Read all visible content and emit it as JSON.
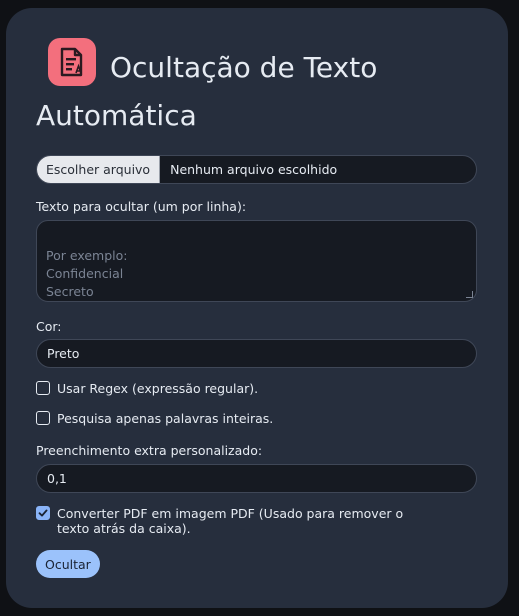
{
  "header": {
    "title": "Ocultação de Texto Automática",
    "icon": "document-redact-icon",
    "icon_color": "#f36f7d"
  },
  "file_input": {
    "button_label": "Escolher arquivo",
    "status": "Nenhum arquivo escolhido"
  },
  "text_area": {
    "label": "Texto para ocultar (um por linha):",
    "placeholder": "Por exemplo:\nConfidencial\nSecreto",
    "value": ""
  },
  "color": {
    "label": "Cor:",
    "value": "Preto"
  },
  "options": {
    "regex_label": "Usar Regex (expressão regular).",
    "regex_checked": false,
    "whole_words_label": "Pesquisa apenas palavras inteiras.",
    "whole_words_checked": false
  },
  "padding": {
    "label": "Preenchimento extra personalizado:",
    "value": "0,1"
  },
  "convert": {
    "label": "Converter PDF em imagem PDF (Usado para remover o texto atrás da caixa).",
    "checked": true
  },
  "submit": {
    "label": "Ocultar"
  },
  "colors": {
    "background": "#0f1115",
    "card": "#262e3d",
    "accent": "#8ab4f8",
    "button": "#9bc2fb"
  }
}
